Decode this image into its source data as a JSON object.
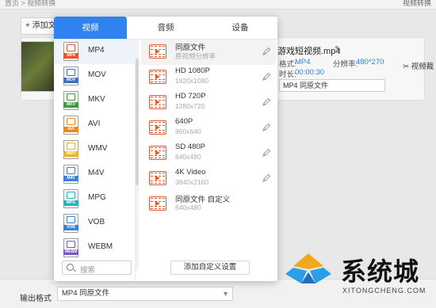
{
  "app": {
    "breadcrumb": "首页 > 视频转换",
    "top_right_link": "视频转换",
    "add_file_label": "+ 添加文",
    "file": {
      "name": "游戏短视频.mp4",
      "format_label": "格式:",
      "format_value": "MP4",
      "resolution_label": "分辨率:",
      "resolution_value": "480*270",
      "duration_label": "时长:",
      "duration_value": "00:00:30",
      "cut_label": "视频裁",
      "output_select": "MP4  同原文件"
    },
    "bottom": {
      "output_label": "输出格式",
      "output_value": "MP4  同原文件"
    }
  },
  "dialog": {
    "tabs": [
      {
        "label": "视频",
        "active": true
      },
      {
        "label": "音频",
        "active": false
      },
      {
        "label": "设备",
        "active": false
      }
    ],
    "formats": [
      {
        "label": "MP4",
        "color": "#e0582b",
        "selected": true
      },
      {
        "label": "MOV",
        "color": "#3c6fc4",
        "selected": false
      },
      {
        "label": "MKV",
        "color": "#3c9b3f",
        "selected": false
      },
      {
        "label": "AVI",
        "color": "#f08a1e",
        "selected": false
      },
      {
        "label": "WMV",
        "color": "#e8b52a",
        "selected": false
      },
      {
        "label": "M4V",
        "color": "#3b7fd9",
        "selected": false
      },
      {
        "label": "MPG",
        "color": "#29b3b8",
        "selected": false
      },
      {
        "label": "VOB",
        "color": "#3a7fd8",
        "selected": false
      },
      {
        "label": "WEBM",
        "color": "#7a55c6",
        "selected": false
      }
    ],
    "search_placeholder": "搜索",
    "presets": [
      {
        "name": "同原文件",
        "sub": "原视频分辨率",
        "selected": true
      },
      {
        "name": "HD 1080P",
        "sub": "1920x1080",
        "selected": false
      },
      {
        "name": "HD 720P",
        "sub": "1280x720",
        "selected": false
      },
      {
        "name": "640P",
        "sub": "960x640",
        "selected": false
      },
      {
        "name": "SD 480P",
        "sub": "640x480",
        "selected": false
      },
      {
        "name": "4K Video",
        "sub": "3840x2160",
        "selected": false
      },
      {
        "name": "同原文件 自定义",
        "sub": "640x480",
        "selected": false
      }
    ],
    "add_custom_label": "添加自定义设置"
  },
  "watermark": {
    "text": "系统城",
    "sub": "XITONGCHENG.COM"
  },
  "colors": {
    "accent": "#2f82f0",
    "preset_icon": "#e0582b",
    "meta_value": "#2d7fd7"
  }
}
